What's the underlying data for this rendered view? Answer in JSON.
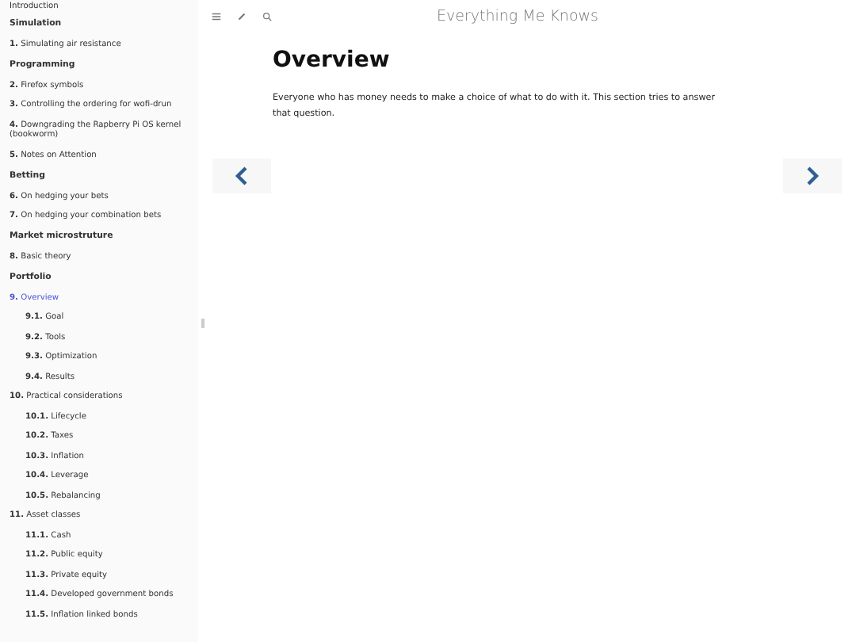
{
  "sidebar": {
    "items": [
      {
        "kind": "chapter",
        "label": "Introduction",
        "selected": false
      },
      {
        "kind": "part",
        "label": "Simulation"
      },
      {
        "kind": "chapter",
        "number": "1.",
        "label": "Simulating air resistance",
        "selected": false
      },
      {
        "kind": "part",
        "label": "Programming"
      },
      {
        "kind": "chapter",
        "number": "2.",
        "label": "Firefox symbols",
        "selected": false
      },
      {
        "kind": "chapter",
        "number": "3.",
        "label": "Controlling the ordering for wofi-drun",
        "selected": false
      },
      {
        "kind": "chapter",
        "number": "4.",
        "label": "Downgrading the Rapberry Pi OS kernel (bookworm)",
        "selected": false
      },
      {
        "kind": "chapter",
        "number": "5.",
        "label": "Notes on Attention",
        "selected": false
      },
      {
        "kind": "part",
        "label": "Betting"
      },
      {
        "kind": "chapter",
        "number": "6.",
        "label": "On hedging your bets",
        "selected": false
      },
      {
        "kind": "chapter",
        "number": "7.",
        "label": "On hedging your combination bets",
        "selected": false
      },
      {
        "kind": "part",
        "label": "Market microstruture"
      },
      {
        "kind": "chapter",
        "number": "8.",
        "label": "Basic theory",
        "selected": false
      },
      {
        "kind": "part",
        "label": "Portfolio"
      },
      {
        "kind": "chapter",
        "number": "9.",
        "label": "Overview",
        "selected": true,
        "children": [
          {
            "kind": "chapter",
            "number": "9.1.",
            "label": "Goal",
            "selected": false
          },
          {
            "kind": "chapter",
            "number": "9.2.",
            "label": "Tools",
            "selected": false
          },
          {
            "kind": "chapter",
            "number": "9.3.",
            "label": "Optimization",
            "selected": false
          },
          {
            "kind": "chapter",
            "number": "9.4.",
            "label": "Results",
            "selected": false
          }
        ]
      },
      {
        "kind": "chapter",
        "number": "10.",
        "label": "Practical considerations",
        "selected": false,
        "children": [
          {
            "kind": "chapter",
            "number": "10.1.",
            "label": "Lifecycle",
            "selected": false
          },
          {
            "kind": "chapter",
            "number": "10.2.",
            "label": "Taxes",
            "selected": false
          },
          {
            "kind": "chapter",
            "number": "10.3.",
            "label": "Inflation",
            "selected": false
          },
          {
            "kind": "chapter",
            "number": "10.4.",
            "label": "Leverage",
            "selected": false
          },
          {
            "kind": "chapter",
            "number": "10.5.",
            "label": "Rebalancing",
            "selected": false
          }
        ]
      },
      {
        "kind": "chapter",
        "number": "11.",
        "label": "Asset classes",
        "selected": false,
        "children": [
          {
            "kind": "chapter",
            "number": "11.1.",
            "label": "Cash",
            "selected": false
          },
          {
            "kind": "chapter",
            "number": "11.2.",
            "label": "Public equity",
            "selected": false
          },
          {
            "kind": "chapter",
            "number": "11.3.",
            "label": "Private equity",
            "selected": false
          },
          {
            "kind": "chapter",
            "number": "11.4.",
            "label": "Developed government bonds",
            "selected": false
          },
          {
            "kind": "chapter",
            "number": "11.5.",
            "label": "Inflation linked bonds",
            "selected": false
          }
        ]
      }
    ]
  },
  "header": {
    "title": "Everything Me Knows"
  },
  "content": {
    "heading": "Overview",
    "paragraph": "Everyone who has money needs to make a choice of what to do with it. This section tries to answer that question."
  }
}
